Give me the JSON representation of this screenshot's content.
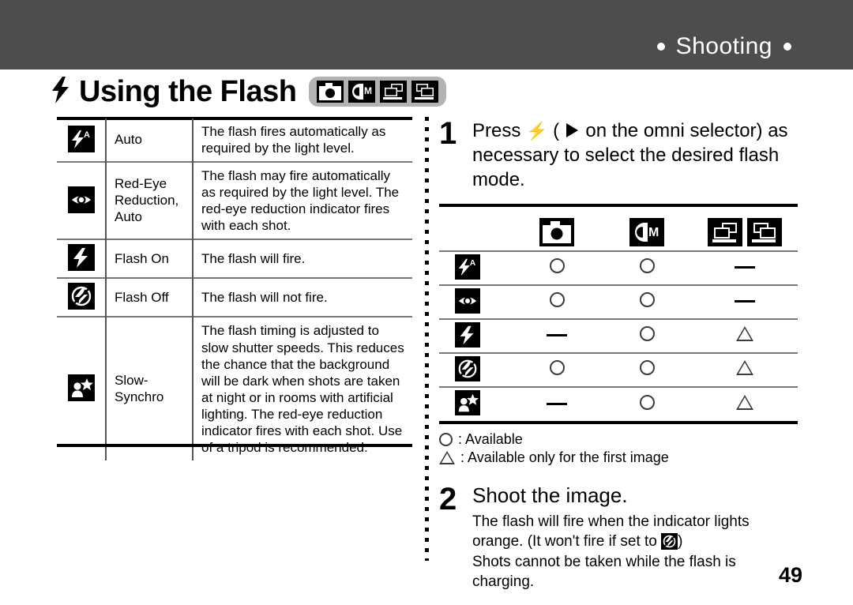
{
  "header": {
    "section_label": "Shooting",
    "bar_color": "#4d4d4d"
  },
  "title": {
    "bolt_glyph": "flash-bolt-icon",
    "text": "Using the Flash",
    "mode_pill_color": "#b3b3b3",
    "mode_icons": [
      {
        "name": "still-image-mode-icon",
        "label": "Still Image"
      },
      {
        "name": "manual-mode-icon",
        "label": "CM"
      },
      {
        "name": "movie-mode-icon",
        "label": "Movie"
      },
      {
        "name": "continuous-mode-icon",
        "label": "Continuous"
      }
    ]
  },
  "flash_modes_table": {
    "rows": [
      {
        "icon": "flash-auto-icon",
        "name": "Auto",
        "description": "The flash fires automatically as required by the light level."
      },
      {
        "icon": "red-eye-reduction-icon",
        "name": "Red-Eye Reduction, Auto",
        "description": "The flash may fire automatically as required by the light level. The red-eye reduction indicator fires with each shot."
      },
      {
        "icon": "flash-on-icon",
        "name": "Flash On",
        "description": "The flash will fire."
      },
      {
        "icon": "flash-off-icon",
        "name": "Flash Off",
        "description": "The flash will not fire."
      },
      {
        "icon": "slow-synchro-icon",
        "name": "Slow-Synchro",
        "description": "The flash timing is adjusted to slow shutter speeds. This reduces the chance that the background will be dark when shots are taken at night or in rooms with artificial lighting. The red-eye reduction indicator fires with each shot. Use of a tripod is recommended."
      }
    ]
  },
  "step1": {
    "number": "1",
    "text_before_bolt": "Press ",
    "text_between": " ( ",
    "text_after": " on the omni selector) as necessary to select the desired flash mode."
  },
  "matrix": {
    "header_icons": [
      {
        "name": "still-image-mode-icon"
      },
      {
        "name": "manual-mode-icon"
      },
      {
        "name": "movie-mode-icon"
      },
      {
        "name": "continuous-mode-icon"
      }
    ],
    "rows": [
      {
        "icon": "flash-auto-icon",
        "values": [
          "circle",
          "circle",
          "dash"
        ]
      },
      {
        "icon": "red-eye-reduction-icon",
        "values": [
          "circle",
          "circle",
          "dash"
        ]
      },
      {
        "icon": "flash-on-icon",
        "values": [
          "dash",
          "circle",
          "triangle"
        ]
      },
      {
        "icon": "flash-off-icon",
        "values": [
          "circle",
          "circle",
          "triangle"
        ]
      },
      {
        "icon": "slow-synchro-icon",
        "values": [
          "dash",
          "circle",
          "triangle"
        ]
      }
    ]
  },
  "legend": {
    "circle_label": ": Available",
    "triangle_label": ": Available only for the first image"
  },
  "step2": {
    "number": "2",
    "title": "Shoot the image.",
    "line1": "The flash will fire when the indicator lights",
    "line2_before_icon": "orange. (It won't fire if set to ",
    "line2_after_icon": ")",
    "line3": "Shots cannot be taken while the flash is",
    "line4": "charging."
  },
  "page_number": "49"
}
